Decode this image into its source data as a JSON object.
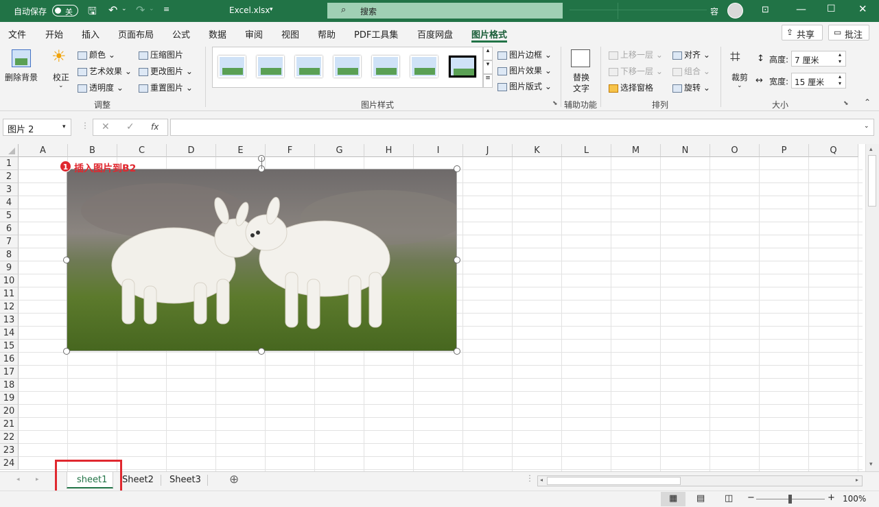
{
  "titlebar": {
    "autosave_label": "自动保存",
    "autosave_state": "关",
    "filename": "Excel.xlsx",
    "search_placeholder": "搜索",
    "user_initial": "容"
  },
  "tabs": [
    "文件",
    "开始",
    "插入",
    "页面布局",
    "公式",
    "数据",
    "审阅",
    "视图",
    "帮助",
    "PDF工具集",
    "百度网盘",
    "图片格式"
  ],
  "share_label": "共享",
  "comment_label": "批注",
  "ribbon": {
    "remove_bg": "删除背景",
    "correct": "校正",
    "color": "颜色",
    "artistic": "艺术效果",
    "transparency": "透明度",
    "compress": "压缩图片",
    "change": "更改图片",
    "reset": "重置图片",
    "group_adjust": "调整",
    "group_styles": "图片样式",
    "border": "图片边框",
    "effects": "图片效果",
    "layout": "图片版式",
    "alt_text_1": "替换",
    "alt_text_2": "文字",
    "group_access": "辅助功能",
    "bring_forward": "上移一层",
    "send_backward": "下移一层",
    "selection_pane": "选择窗格",
    "align": "对齐",
    "group_obj": "组合",
    "rotate": "旋转",
    "group_arrange": "排列",
    "crop": "裁剪",
    "height_label": "高度:",
    "height_value": "7 厘米",
    "width_label": "宽度:",
    "width_value": "15 厘米",
    "group_size": "大小"
  },
  "namebox": "图片 2",
  "fx": "fx",
  "columns": [
    "A",
    "B",
    "C",
    "D",
    "E",
    "F",
    "G",
    "H",
    "I",
    "J",
    "K",
    "L",
    "M",
    "N",
    "O",
    "P",
    "Q"
  ],
  "rows": [
    "1",
    "2",
    "3",
    "4",
    "5",
    "6",
    "7",
    "8",
    "9",
    "10",
    "11",
    "12",
    "13",
    "14",
    "15",
    "16",
    "17",
    "18",
    "19",
    "20",
    "21",
    "22",
    "23",
    "24"
  ],
  "annotation": {
    "badge": "1",
    "text": "插入图片到B2"
  },
  "sheets": [
    "sheet1",
    "Sheet2",
    "Sheet3"
  ],
  "zoom": "100%",
  "colors": {
    "excel_green": "#217346",
    "annotation_red": "#e0282f"
  }
}
